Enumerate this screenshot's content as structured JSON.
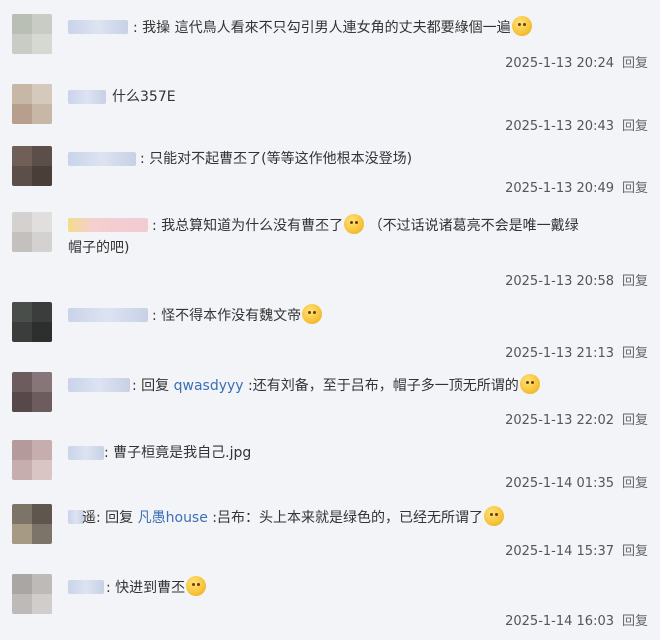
{
  "comments": [
    {
      "prefix": ":",
      "text": "我操 這代鳥人看來不只勾引男人連女角的丈夫都要綠個一遍",
      "emoji": "face-with-mask-emoji",
      "time": "2025-1-13 20:24",
      "reply_label": "回复"
    },
    {
      "prefix": "",
      "text": "什么357E",
      "time": "2025-1-13 20:43",
      "reply_label": "回复"
    },
    {
      "prefix": ":",
      "text": "只能对不起曹丕了(等等这作他根本没登场)",
      "time": "2025-1-13 20:49",
      "reply_label": "回复"
    },
    {
      "prefix": ":",
      "text": "我总算知道为什么没有曹丕了",
      "emoji": "smile-emoji",
      "text_after": "（不过话说诸葛亮不会是唯一戴绿",
      "text_line2": "帽子的吧)",
      "time": "2025-1-13 20:58",
      "reply_label": "回复"
    },
    {
      "prefix": ":",
      "text": "怪不得本作没有魏文帝",
      "emoji": "smile-emoji",
      "time": "2025-1-13 21:13",
      "reply_label": "回复"
    },
    {
      "prefix": ":",
      "reply_word": "回复",
      "reply_to": "qwasdyyy",
      "text": ":还有刘备，至于吕布，帽子多一顶无所谓的",
      "emoji": "smile-emoji",
      "time": "2025-1-13 22:02",
      "reply_label": "回复"
    },
    {
      "prefix": ":",
      "text": "曹子桓竟是我自己.jpg",
      "time": "2025-1-14 01:35",
      "reply_label": "回复"
    },
    {
      "prefix": "遥:",
      "reply_word": "回复",
      "reply_to": "凡愚house",
      "text": ":吕布：头上本来就是绿色的，已经无所谓了",
      "emoji": "tongue-out-emoji",
      "time": "2025-1-14 15:37",
      "reply_label": "回复"
    },
    {
      "prefix": ":",
      "text": "快进到曹丕",
      "emoji": "heart-eyes-emoji",
      "time": "2025-1-14 16:03",
      "reply_label": "回复"
    }
  ],
  "colors": {
    "background": "#f3f4f8",
    "link": "#3b6fb5",
    "text": "#333333",
    "meta": "#555555"
  }
}
